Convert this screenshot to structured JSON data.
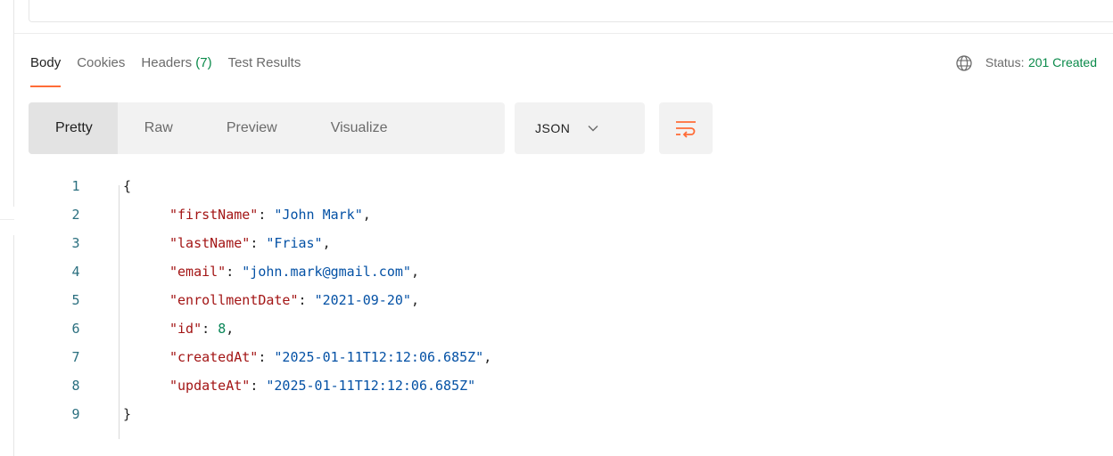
{
  "tabs": [
    {
      "label": "Body",
      "active": true
    },
    {
      "label": "Cookies",
      "active": false
    },
    {
      "label": "Headers",
      "count": "(7)",
      "active": false
    },
    {
      "label": "Test Results",
      "active": false
    }
  ],
  "status": {
    "label": "Status:",
    "value": "201 Created",
    "color": "#0a8a4a",
    "icon": "globe-icon"
  },
  "view_modes": [
    {
      "label": "Pretty",
      "active": true
    },
    {
      "label": "Raw",
      "active": false
    },
    {
      "label": "Preview",
      "active": false
    },
    {
      "label": "Visualize",
      "active": false
    }
  ],
  "format": {
    "selected": "JSON",
    "icon": "chevron-down-icon"
  },
  "wrap_button": {
    "icon": "wrap-lines-icon",
    "color": "#ff6c37"
  },
  "accent_color": "#ff6c37",
  "code": {
    "line_numbers": [
      "1",
      "2",
      "3",
      "4",
      "5",
      "6",
      "7",
      "8",
      "9"
    ],
    "open_brace": "{",
    "close_brace": "}",
    "fields": [
      {
        "key": "\"firstName\"",
        "value": "\"John Mark\"",
        "type": "string",
        "comma": ","
      },
      {
        "key": "\"lastName\"",
        "value": "\"Frias\"",
        "type": "string",
        "comma": ","
      },
      {
        "key": "\"email\"",
        "value": "\"john.mark@gmail.com\"",
        "type": "string",
        "comma": ","
      },
      {
        "key": "\"enrollmentDate\"",
        "value": "\"2021-09-20\"",
        "type": "string",
        "comma": ","
      },
      {
        "key": "\"id\"",
        "value": "8",
        "type": "number",
        "comma": ","
      },
      {
        "key": "\"createdAt\"",
        "value": "\"2025-01-11T12:12:06.685Z\"",
        "type": "string",
        "comma": ","
      },
      {
        "key": "\"updateAt\"",
        "value": "\"2025-01-11T12:12:06.685Z\"",
        "type": "string",
        "comma": ""
      }
    ]
  }
}
